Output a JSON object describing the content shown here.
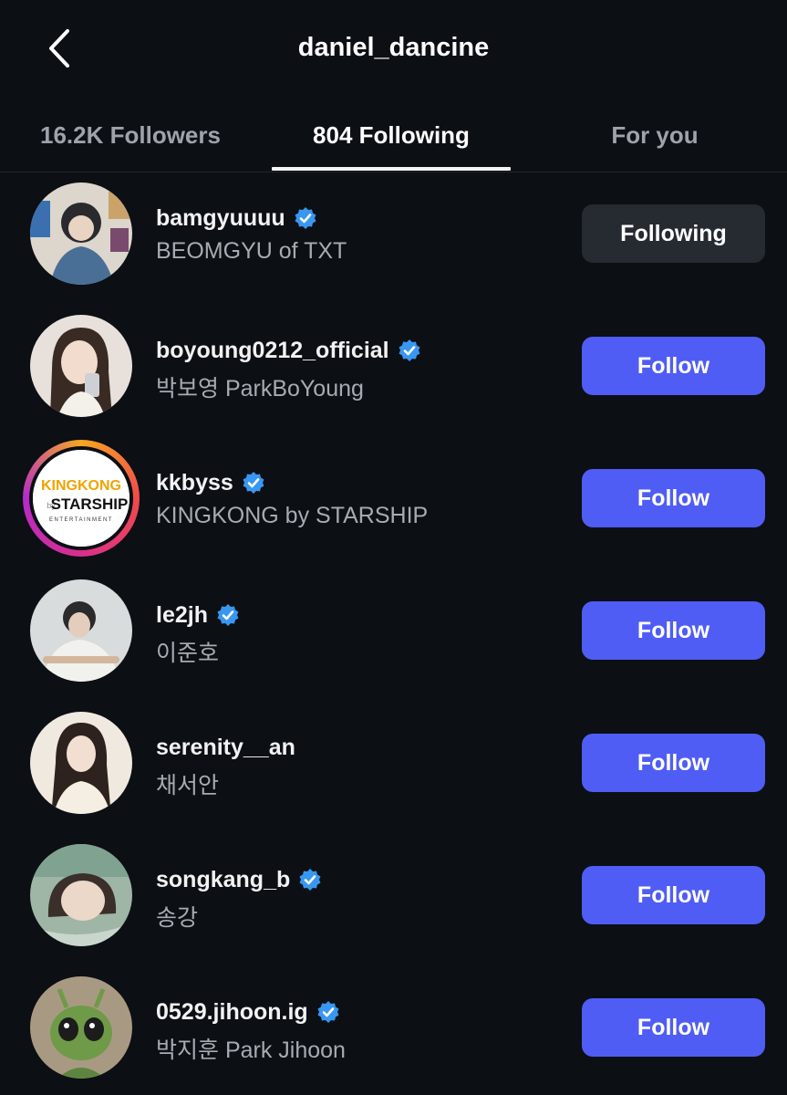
{
  "header": {
    "title": "daniel_dancine",
    "back_icon": "chevron-left-icon"
  },
  "tabs": [
    {
      "label": "16.2K Followers",
      "active": false
    },
    {
      "label": "804 Following",
      "active": true
    },
    {
      "label": "For you",
      "active": false
    }
  ],
  "accounts": [
    {
      "username": "bamgyuuuu",
      "verified": true,
      "full_name": "BEOMGYU of TXT",
      "button": "Following",
      "button_state": "following"
    },
    {
      "username": "boyoung0212_official",
      "verified": true,
      "full_name": "박보영 ParkBoYoung",
      "button": "Follow",
      "button_state": "follow"
    },
    {
      "username": "kkbyss",
      "verified": true,
      "full_name": "KINGKONG by STARSHIP",
      "button": "Follow",
      "button_state": "follow",
      "has_story_ring": true,
      "logo": {
        "line1": "KINGKONG",
        "line2_prefix": "by",
        "line2": "STARSHIP",
        "line3": "ENTERTAINMENT"
      }
    },
    {
      "username": "le2jh",
      "verified": true,
      "full_name": "이준호",
      "button": "Follow",
      "button_state": "follow"
    },
    {
      "username": "serenity__an",
      "verified": false,
      "full_name": "채서안",
      "button": "Follow",
      "button_state": "follow"
    },
    {
      "username": "songkang_b",
      "verified": true,
      "full_name": "송강",
      "button": "Follow",
      "button_state": "follow"
    },
    {
      "username": "0529.jihoon.ig",
      "verified": true,
      "full_name": "박지훈 Park Jihoon",
      "button": "Follow",
      "button_state": "follow"
    }
  ],
  "colors": {
    "background": "#0c0f14",
    "follow_button": "#4f5df5",
    "following_button": "#262a31",
    "verified_badge": "#3897f0",
    "secondary_text": "#a7abb2"
  }
}
